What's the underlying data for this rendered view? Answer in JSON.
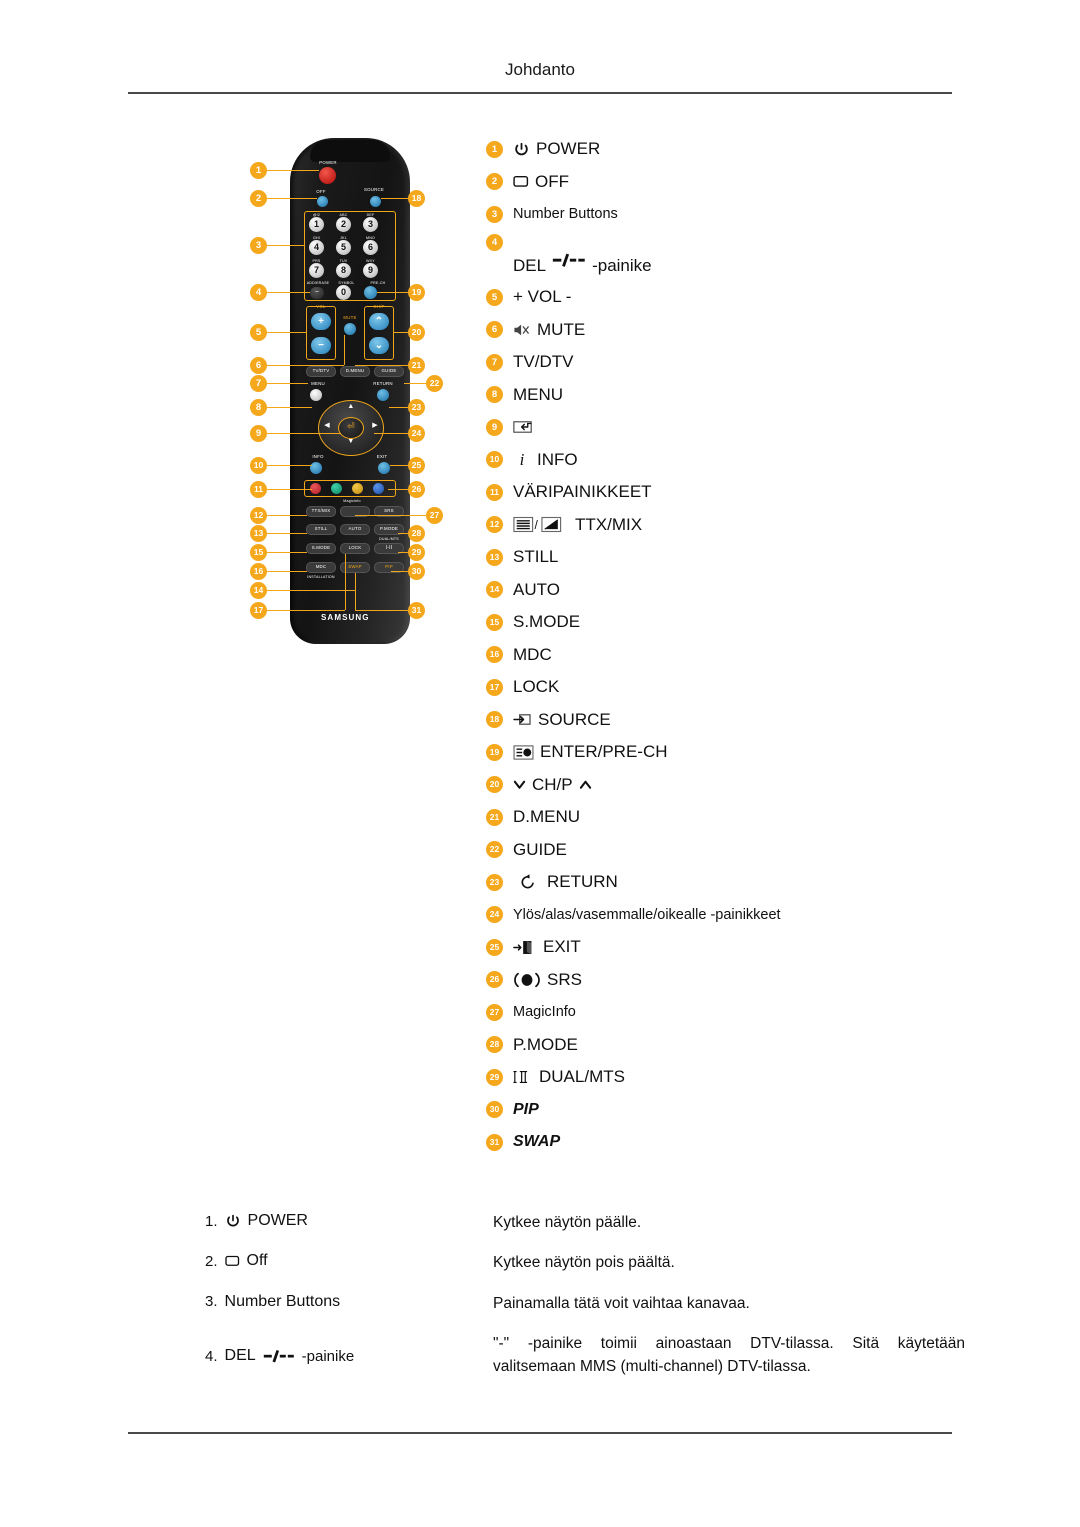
{
  "header": {
    "title": "Johdanto"
  },
  "remote": {
    "brand": "SAMSUNG",
    "labels": {
      "power": "POWER",
      "off": "OFF",
      "source": "SOURCE",
      "vol": "VOL",
      "mute": "MUTE",
      "chp": "CH/P",
      "tvdtv": "TV/DTV",
      "dmenu": "D.MENU",
      "guide": "GUIDE",
      "menu": "MENU",
      "return": "RETURN",
      "info": "INFO",
      "exit": "EXIT",
      "ttxmix": "TTX/MIX",
      "magicinfo": "MagicInfo",
      "srs": "SRS",
      "still": "STILL",
      "auto": "AUTO",
      "pmode": "P.MODE",
      "smode": "S.MODE",
      "lock": "LOCK",
      "dualmts": "DUAL/MTS",
      "mdc": "MDC",
      "swap": "SWAP",
      "pip": "PIP"
    },
    "keypad_digits": [
      "1",
      "2",
      "3",
      "4",
      "5",
      "6",
      "7",
      "8",
      "9",
      "0"
    ],
    "keypad_letters": [
      "@!2",
      "ABC",
      "DEF",
      "GHI",
      "JKL",
      "MNO",
      "PRS",
      "TUV",
      "WXY",
      "SYMBOL"
    ],
    "keypad_extra": [
      "ADD/ERASE",
      "SYMBOL",
      "PRE-CH/ENTER"
    ],
    "mdc_sub": "INSTALLATION",
    "vol_plus": "+",
    "vol_minus": "−",
    "del_minus": "−"
  },
  "legend": [
    {
      "n": "1",
      "label": "POWER",
      "icon": "power-icon"
    },
    {
      "n": "2",
      "label": "OFF",
      "icon": "off-icon"
    },
    {
      "n": "3",
      "label": "Number Buttons",
      "icon": ""
    },
    {
      "n": "4",
      "label": "DEL",
      "icon": "del-icon",
      "suffix": "-painike"
    },
    {
      "n": "5",
      "label": "+ VOL -",
      "icon": ""
    },
    {
      "n": "6",
      "label": "MUTE",
      "icon": "mute-icon"
    },
    {
      "n": "7",
      "label": "TV/DTV",
      "icon": ""
    },
    {
      "n": "8",
      "label": "MENU",
      "icon": ""
    },
    {
      "n": "9",
      "label": "",
      "icon": "enter-icon"
    },
    {
      "n": "10",
      "label": "INFO",
      "icon": "info-icon"
    },
    {
      "n": "11",
      "label": "VÄRIPAINIKKEET",
      "icon": ""
    },
    {
      "n": "12",
      "label": "TTX/MIX",
      "icon": "ttx-mix-icon"
    },
    {
      "n": "13",
      "label": "STILL",
      "icon": ""
    },
    {
      "n": "14",
      "label": "AUTO",
      "icon": ""
    },
    {
      "n": "15",
      "label": "S.MODE",
      "icon": ""
    },
    {
      "n": "16",
      "label": "MDC",
      "icon": ""
    },
    {
      "n": "17",
      "label": "LOCK",
      "icon": ""
    },
    {
      "n": "18",
      "label": "SOURCE",
      "icon": "source-icon"
    },
    {
      "n": "19",
      "label": "ENTER/PRE-CH",
      "icon": "enter-prech-icon"
    },
    {
      "n": "20",
      "label": "CH/P",
      "icon": "chp-arrows-icon"
    },
    {
      "n": "21",
      "label": "D.MENU",
      "icon": ""
    },
    {
      "n": "22",
      "label": "GUIDE",
      "icon": ""
    },
    {
      "n": "23",
      "label": "RETURN",
      "icon": "return-icon"
    },
    {
      "n": "24",
      "label": "Ylös/alas/vasemmalle/oikealle -painikkeet",
      "icon": ""
    },
    {
      "n": "25",
      "label": "EXIT",
      "icon": "exit-icon"
    },
    {
      "n": "26",
      "label": "SRS",
      "icon": "srs-icon"
    },
    {
      "n": "27",
      "label": "MagicInfo",
      "icon": ""
    },
    {
      "n": "28",
      "label": "P.MODE",
      "icon": ""
    },
    {
      "n": "29",
      "label": "DUAL/MTS",
      "icon": "dual-mts-icon"
    },
    {
      "n": "30",
      "label": "PIP",
      "icon": ""
    },
    {
      "n": "31",
      "label": "SWAP",
      "icon": ""
    }
  ],
  "descriptions": [
    {
      "num": "1.",
      "term": "POWER",
      "icon": "power-icon",
      "text": "Kytkee näytön päälle."
    },
    {
      "num": "2.",
      "term": "Off",
      "icon": "off-icon",
      "text": "Kytkee näytön pois päältä."
    },
    {
      "num": "3.",
      "term": "Number Buttons",
      "icon": "",
      "text": "Painamalla tätä voit vaihtaa kanavaa."
    },
    {
      "num": "4.",
      "term": "DEL",
      "icon": "del-icon",
      "suffix": "-painike",
      "text": "\"-\" -painike toimii ainoastaan DTV-tilassa. Sitä käytetään valitsemaan MMS (multi-channel) DTV-tilassa."
    }
  ],
  "colors": {
    "badge": "#f5a81c",
    "leader": "#f2a71b",
    "rule": "#4a4a4a",
    "remote_body": "#1a1a1a",
    "key_blue": "#3f95c8",
    "power_red": "#d42a20",
    "color_buttons": [
      "#cc2229",
      "#10a37f",
      "#e0a51c",
      "#2266cc"
    ]
  }
}
